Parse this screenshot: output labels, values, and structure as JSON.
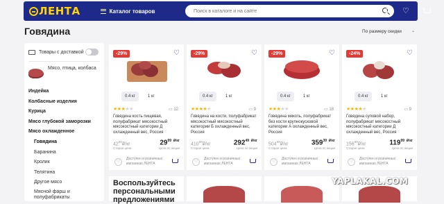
{
  "header": {
    "logo_text": "ЛЕНТА",
    "catalog_label": "Каталог товаров",
    "search_placeholder": "Поиск в каталоге и на сайте",
    "brand_color": "#1e2a8a",
    "logo_color": "#ffd200"
  },
  "page": {
    "title": "Говядина",
    "sort_label": "По размеру скидки"
  },
  "sidebar": {
    "delivery_label": "Товары с доставкой",
    "delivery_enabled": false,
    "category_label": "Мясо, птица, колбаса",
    "items": [
      {
        "label": "Индейка"
      },
      {
        "label": "Колбасные изделия"
      },
      {
        "label": "Курица"
      },
      {
        "label": "Мясо глубокой заморозки"
      },
      {
        "label": "Мясо охлажденное"
      }
    ],
    "subitems": [
      {
        "label": "Говядина",
        "active": true
      },
      {
        "label": "Баранина",
        "active": false
      },
      {
        "label": "Кролик",
        "active": false
      },
      {
        "label": "Телятина",
        "active": false
      },
      {
        "label": "Другое мясо",
        "active": false
      },
      {
        "label": "Мясной фарш и полуфабрикаты",
        "active": false
      }
    ]
  },
  "products": [
    {
      "discount": "-29%",
      "weights": [
        "0.4 кг",
        "1 кг"
      ],
      "rating": 3,
      "reviews": "12",
      "description": "Говядина кость пищевая, полуфабрикат мясокостный мясокостный категории Д охлажденный вес, Россия",
      "old_price_main": "42",
      "old_price_cents": "59",
      "old_price_unit": "₽/кг",
      "old_caption": "Старая цена",
      "new_price_main": "29",
      "new_price_cents": "99",
      "new_price_unit": "₽/кг",
      "new_caption": "Цена по акции",
      "availability": "Доступен в розничных магазинах ЛЕНТА"
    },
    {
      "discount": "-29%",
      "weights": [
        "0.4 кг",
        "1 кг"
      ],
      "rating": 3.5,
      "reviews": "9",
      "description": "Говядина на кости, полуфабрикат мясокостный мясокостный категории Б охлажденный вес, Россия",
      "old_price_main": "410",
      "old_price_cents": "99",
      "old_price_unit": "₽/кг",
      "old_caption": "Старая цена",
      "new_price_main": "292",
      "new_price_cents": "49",
      "new_price_unit": "₽/кг",
      "new_caption": "Цена по акции",
      "availability": "Доступен в розничных магазинах ЛЕНТА"
    },
    {
      "discount": "-29%",
      "weights": [
        "0.4 кг",
        "1 кг"
      ],
      "rating": 3,
      "reviews": "18",
      "description": "Говядина мякоть, полуфабрикат без кости крупнокусковой категории А охлажденный вес, Россия",
      "old_price_main": "504",
      "old_price_cents": "99",
      "old_price_unit": "₽/кг",
      "old_caption": "Старая цена",
      "new_price_main": "359",
      "new_price_cents": "39",
      "new_price_unit": "₽/кг",
      "new_caption": "Цена по акции",
      "availability": "Доступен в розничных магазинах ЛЕНТА"
    },
    {
      "discount": "-24%",
      "weights": [
        "0.4 кг",
        "1 кг"
      ],
      "rating": 3.5,
      "reviews": "9",
      "description": "Говядина суповой набор, полуфабрикат мясокостный мясокостный категории Д охлажденный вес, Россия",
      "old_price_main": "156",
      "old_price_cents": "99",
      "old_price_unit": "₽/кг",
      "old_caption": "Старая цена",
      "new_price_main": "119",
      "new_price_cents": "99",
      "new_price_unit": "₽/кг",
      "new_caption": "Цена по акции",
      "availability": "Доступен в розничных магазинах ЛЕНТА"
    }
  ],
  "promo": {
    "title": "Воспользуйтесь персональными предложениями"
  },
  "watermark": "YAPLAKAL.COM"
}
